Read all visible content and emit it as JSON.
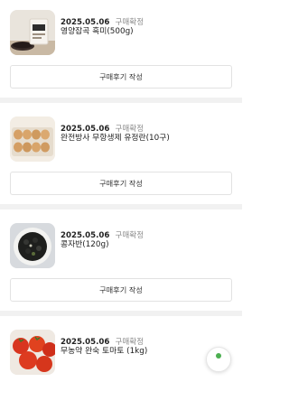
{
  "colors": {
    "divider": "#f1f1f1",
    "status_text": "#8a8a8a",
    "fab_accent": "#4caf50"
  },
  "orders": [
    {
      "date": "2025.05.06",
      "status": "구매확정",
      "product": "영양잡곡 흑미(500g)",
      "review_button": "구매후기 작성",
      "image_icon": "rice-bag-photo-icon"
    },
    {
      "date": "2025.05.06",
      "status": "구매확정",
      "product": "완전방사 무항생제 유정란(10구)",
      "review_button": "구매후기 작성",
      "image_icon": "egg-tray-photo-icon"
    },
    {
      "date": "2025.05.06",
      "status": "구매확정",
      "product": "콩자반(120g)",
      "review_button": "구매후기 작성",
      "image_icon": "black-beans-photo-icon"
    },
    {
      "date": "2025.05.06",
      "status": "구매확정",
      "product": "무농약 완숙 토마토 (1kg)",
      "review_button": "구매후기 작성",
      "image_icon": "tomato-photo-icon"
    }
  ],
  "floating_button": {
    "icon": "chat-icon"
  }
}
